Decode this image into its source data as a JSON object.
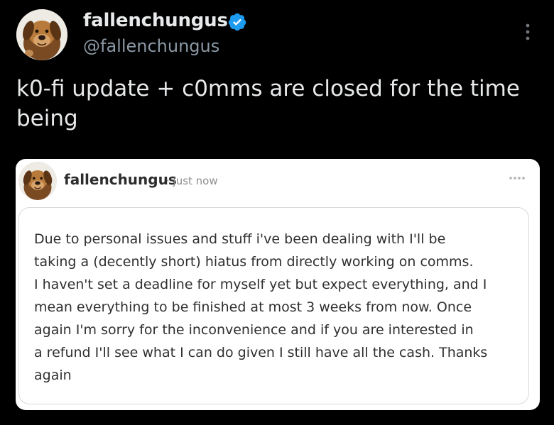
{
  "author": {
    "display_name": "fallenchungus",
    "handle": "@fallenchungus",
    "verified": true,
    "avatar_icon": "dog-avatar-icon"
  },
  "tweet": {
    "text": "k0-fi update + c0mms are closed for the time\nbeing"
  },
  "quoted_post": {
    "author_name": "fallenchungus",
    "time": "· just now",
    "avatar_icon": "dog-avatar-icon",
    "body_lines": [
      "Due to personal issues and stuff i've been dealing with I'll be",
      "taking a (decently short) hiatus from directly working on comms.",
      "I haven't set a deadline for myself yet but expect everything, and I",
      "mean everything to be finished at most 3 weeks from now. Once",
      "again I'm sorry for the inconvenience and if you are interested in",
      "a refund I'll see what I can do given I still have all the cash. Thanks",
      "again"
    ]
  },
  "colors": {
    "background": "#000000",
    "primary_text": "#e7e9ea",
    "secondary_text": "#8b98a5",
    "verified_badge": "#1d9bf0",
    "card_background": "#ffffff"
  }
}
